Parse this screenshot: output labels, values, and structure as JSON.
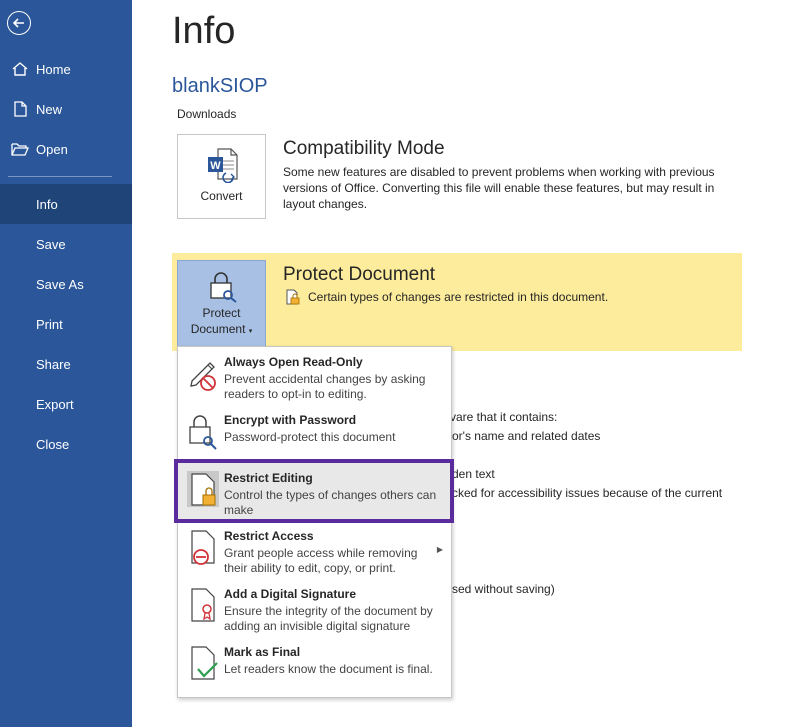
{
  "sidebar": {
    "items": [
      {
        "label": "Home",
        "icon": "home-icon"
      },
      {
        "label": "New",
        "icon": "new-document-icon"
      },
      {
        "label": "Open",
        "icon": "folder-open-icon"
      },
      {
        "label": "Info"
      },
      {
        "label": "Save"
      },
      {
        "label": "Save As"
      },
      {
        "label": "Print"
      },
      {
        "label": "Share"
      },
      {
        "label": "Export"
      },
      {
        "label": "Close"
      }
    ],
    "active": "Info",
    "color": "#2b579a"
  },
  "main": {
    "title": "Info",
    "doc_name": "blankSIOP",
    "doc_path": "Downloads",
    "compat": {
      "button_label": "Convert",
      "title": "Compatibility Mode",
      "description": "Some new features are disabled to prevent problems when working with previous versions of Office. Converting this file will enable these features, but may result in layout changes."
    },
    "protect": {
      "button_line1": "Protect",
      "button_line2": "Document",
      "title": "Protect Document",
      "description": "Certain types of changes are restricted in this document.",
      "band_color": "#fcec9c"
    },
    "background_fragments": [
      "vare that it contains:",
      "or's name and related dates",
      "den text",
      "cked for accessibility issues because of the current",
      "sed without saving)"
    ]
  },
  "menu": {
    "items": [
      {
        "title": "Always Open Read-Only",
        "desc": "Prevent accidental changes by asking readers to opt-in to editing.",
        "icon": "pencil-prohibited-icon"
      },
      {
        "title": "Encrypt with Password",
        "desc": "Password-protect this document",
        "icon": "lock-key-icon"
      },
      {
        "title": "Restrict Editing",
        "desc": "Control the types of changes others can make",
        "icon": "document-lock-icon"
      },
      {
        "title": "Restrict Access",
        "desc": "Grant people access while removing their ability to edit, copy, or print.",
        "icon": "document-restricted-icon"
      },
      {
        "title": "Add a Digital Signature",
        "desc": "Ensure the integrity of the document by adding an invisible digital signature",
        "icon": "document-ribbon-icon"
      },
      {
        "title": "Mark as Final",
        "desc": "Let readers know the document is final.",
        "icon": "document-check-icon"
      }
    ],
    "highlight_color": "#5a2b9c"
  }
}
